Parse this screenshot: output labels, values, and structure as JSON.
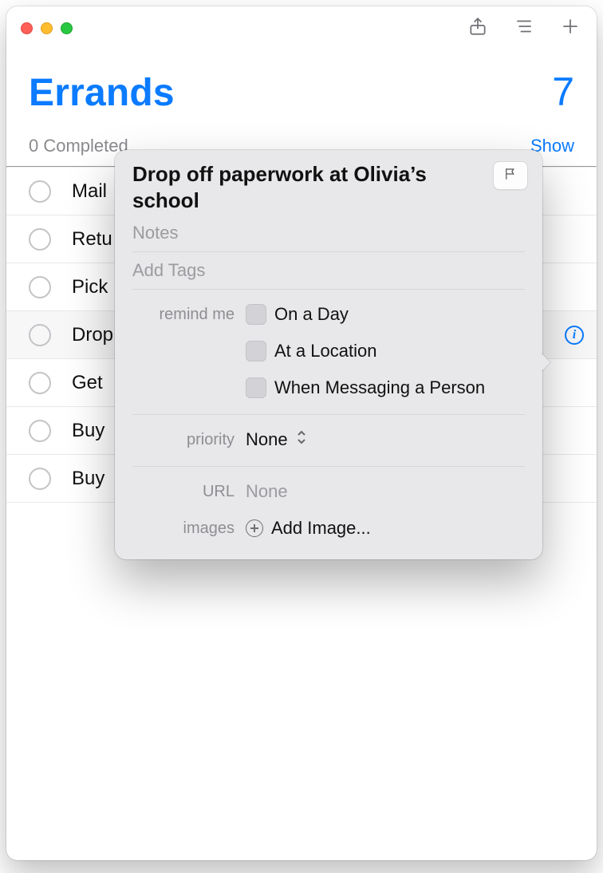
{
  "list": {
    "title": "Errands",
    "count": "7",
    "status": "0 Completed",
    "show_label": "Show",
    "items": [
      {
        "title": "Mail"
      },
      {
        "title": "Retu"
      },
      {
        "title": "Pick"
      },
      {
        "title": "Drop",
        "selected": true
      },
      {
        "title": "Get "
      },
      {
        "title": "Buy "
      },
      {
        "title": "Buy "
      }
    ]
  },
  "popover": {
    "title": "Drop off paperwork at Olivia’s school",
    "notes_placeholder": "Notes",
    "tags_placeholder": "Add Tags",
    "labels": {
      "remind_me": "remind me",
      "priority": "priority",
      "url": "URL",
      "images": "images"
    },
    "remind_options": {
      "on_day": "On a Day",
      "at_location": "At a Location",
      "when_messaging": "When Messaging a Person"
    },
    "priority_value": "None",
    "url_value": "None",
    "add_image_label": "Add Image..."
  }
}
